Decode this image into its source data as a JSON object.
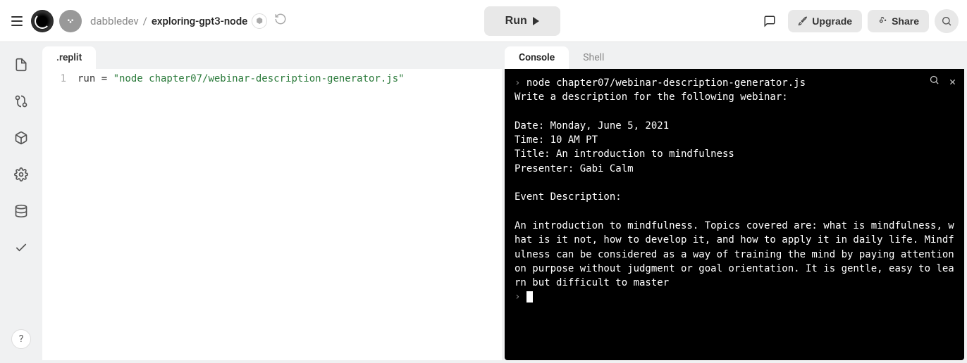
{
  "header": {
    "user": "dabbledev",
    "separator": "/",
    "project": "exploring-gpt3-node",
    "lang_icon": "⬢",
    "run_label": "Run",
    "upgrade_label": "Upgrade",
    "share_label": "Share"
  },
  "editor": {
    "tab_label": ".replit",
    "line_number": "1",
    "code_prefix": "run = ",
    "code_string": "\"node chapter07/webinar-description-generator.js\""
  },
  "right_panel": {
    "tabs": {
      "console": "Console",
      "shell": "Shell"
    }
  },
  "console": {
    "command_prefix": "› ",
    "command": "node chapter07/webinar-description-generator.js",
    "output": "Write a description for the following webinar:\n\nDate: Monday, June 5, 2021\nTime: 10 AM PT\nTitle: An introduction to mindfulness\nPresenter: Gabi Calm\n\nEvent Description:\n\nAn introduction to mindfulness. Topics covered are: what is mindfulness, what is it not, how to develop it, and how to apply it in daily life. Mindfulness can be considered as a way of training the mind by paying attention on purpose without judgment or goal orientation. It is gentle, easy to learn but difficult to master",
    "prompt_caret": "› "
  },
  "sidebar": {
    "help": "?"
  }
}
